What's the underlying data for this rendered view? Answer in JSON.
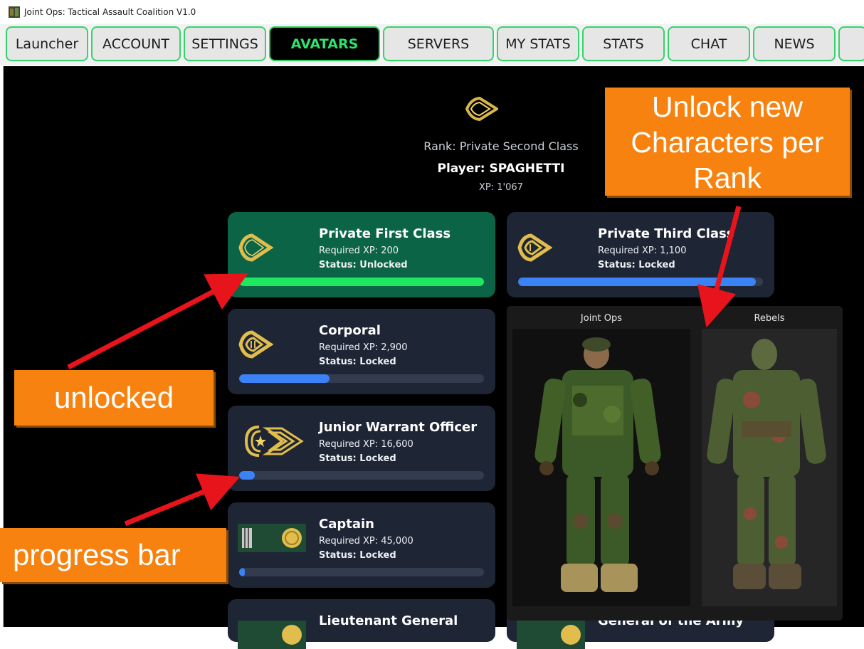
{
  "window": {
    "title": "Joint Ops: Tactical Assault Coalition V1.0"
  },
  "tabs": [
    "Launcher",
    "ACCOUNT",
    "SETTINGS",
    "AVATARS",
    "SERVERS",
    "MY STATS",
    "STATS",
    "CHAT",
    "NEWS",
    ""
  ],
  "active_tab": "AVATARS",
  "header": {
    "rank": "Rank: Private Second Class",
    "player": "Player: SPAGHETTI",
    "xp": "XP: 1'067"
  },
  "ranks": [
    {
      "title": "Private First Class",
      "required": "Required XP: 200",
      "status": "Status: Unlocked",
      "progress": 1.0,
      "icon": "chevron-1-insignia-icon"
    },
    {
      "title": "Private Third Class",
      "required": "Required XP: 1,100",
      "status": "Status: Locked",
      "progress": 0.97,
      "icon": "chevron-2-insignia-icon"
    },
    {
      "title": "Corporal",
      "required": "Required XP: 2,900",
      "status": "Status: Locked",
      "progress": 0.37,
      "icon": "chevron-2-insignia-icon"
    },
    {
      "title": "Junior Warrant Officer",
      "required": "Required XP: 16,600",
      "status": "Status: Locked",
      "progress": 0.065,
      "icon": "sergeant-star-insignia-icon"
    },
    {
      "title": "Captain",
      "required": "Required XP: 45,000",
      "status": "Status: Locked",
      "progress": 0.024,
      "icon": "captain-bars-insignia-icon"
    },
    {
      "title": "Lieutenant General",
      "required": "",
      "status": "",
      "progress": 0,
      "icon": "general-insignia-icon"
    },
    {
      "title": "General of the Army",
      "required": "",
      "status": "",
      "progress": 0,
      "icon": "general-insignia-icon"
    }
  ],
  "characters": {
    "joint_ops_label": "Joint Ops",
    "rebels_label": "Rebels"
  },
  "annotations": {
    "unlock_note": "Unlock new Characters per Rank",
    "unlocked_note": "unlocked",
    "progress_note": "progress bar"
  },
  "colors": {
    "tab_border": "#35d46a",
    "active_tab_text": "#2ee26a",
    "unlocked_card": "#0b6445",
    "progress_fill": "#3b82f6",
    "unlocked_fill": "#1ee85f",
    "callout": "#f7820f",
    "arrow": "#e8141c"
  }
}
